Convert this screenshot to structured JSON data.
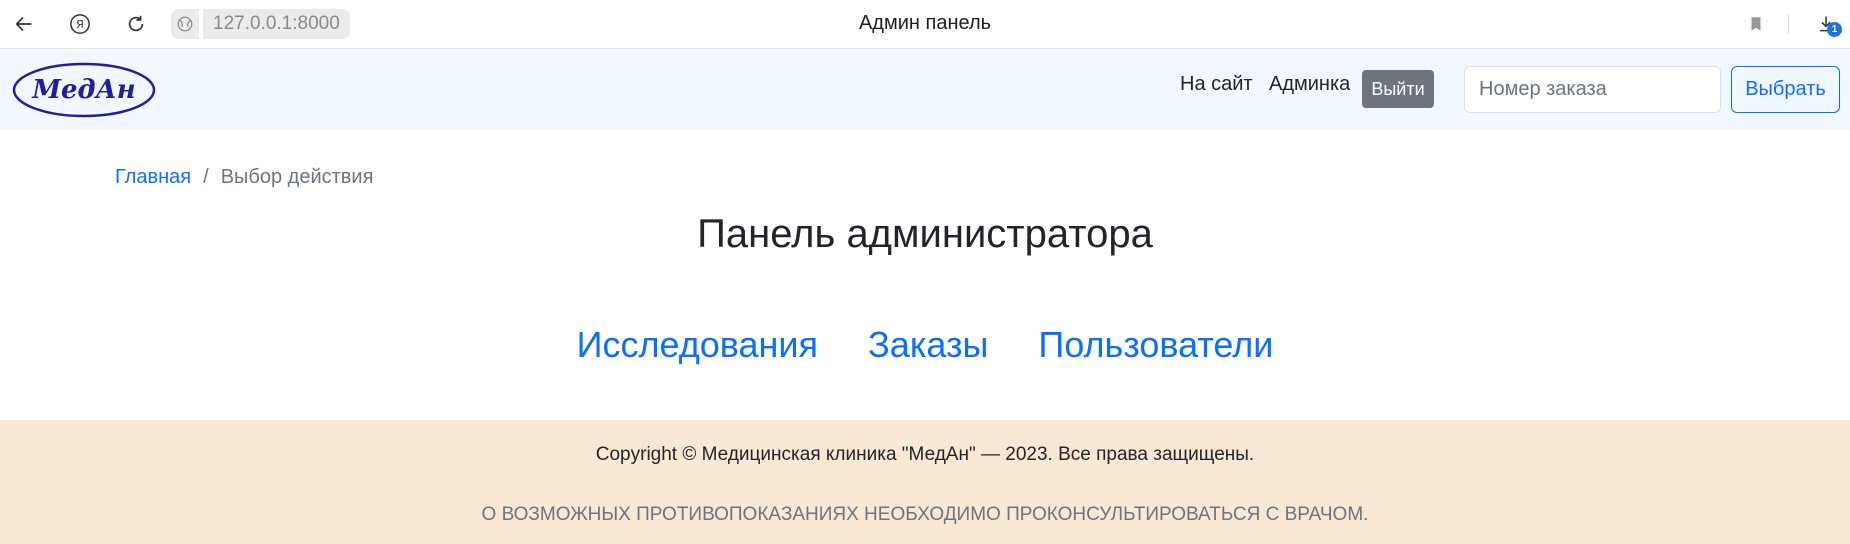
{
  "browser": {
    "url": "127.0.0.1:8000",
    "window_title": "Админ панель",
    "downloads_count": "1",
    "icons": [
      "back-arrow-icon",
      "yandex-icon",
      "reload-icon",
      "site-info-icon",
      "bookmark-icon",
      "download-icon"
    ]
  },
  "navbar": {
    "logo_text": "МедАн",
    "links": [
      "На сайт",
      "Админка"
    ],
    "logout_label": "Выйти",
    "order_placeholder": "Номер заказа",
    "order_value": "",
    "choose_label": "Выбрать"
  },
  "breadcrumb": {
    "home": "Главная",
    "separator": "/",
    "current": "Выбор действия"
  },
  "page": {
    "title": "Панель администратора",
    "actions": [
      "Исследования",
      "Заказы",
      "Пользователи"
    ]
  },
  "footer": {
    "copyright": "Copyright © Медицинская клиника \"МедАн\" — 2023. Все права защищены.",
    "warning": "О ВОЗМОЖНЫХ ПРОТИВОПОКАЗАНИЯХ НЕОБХОДИМО ПРОКОНСУЛЬТИРОВАТЬСЯ С ВРАЧОМ."
  },
  "colors": {
    "navbar_bg": "#f1f8ff",
    "footer_bg": "#f9e8d4",
    "link": "#0d6efd",
    "logo": "#1f1f9e"
  }
}
